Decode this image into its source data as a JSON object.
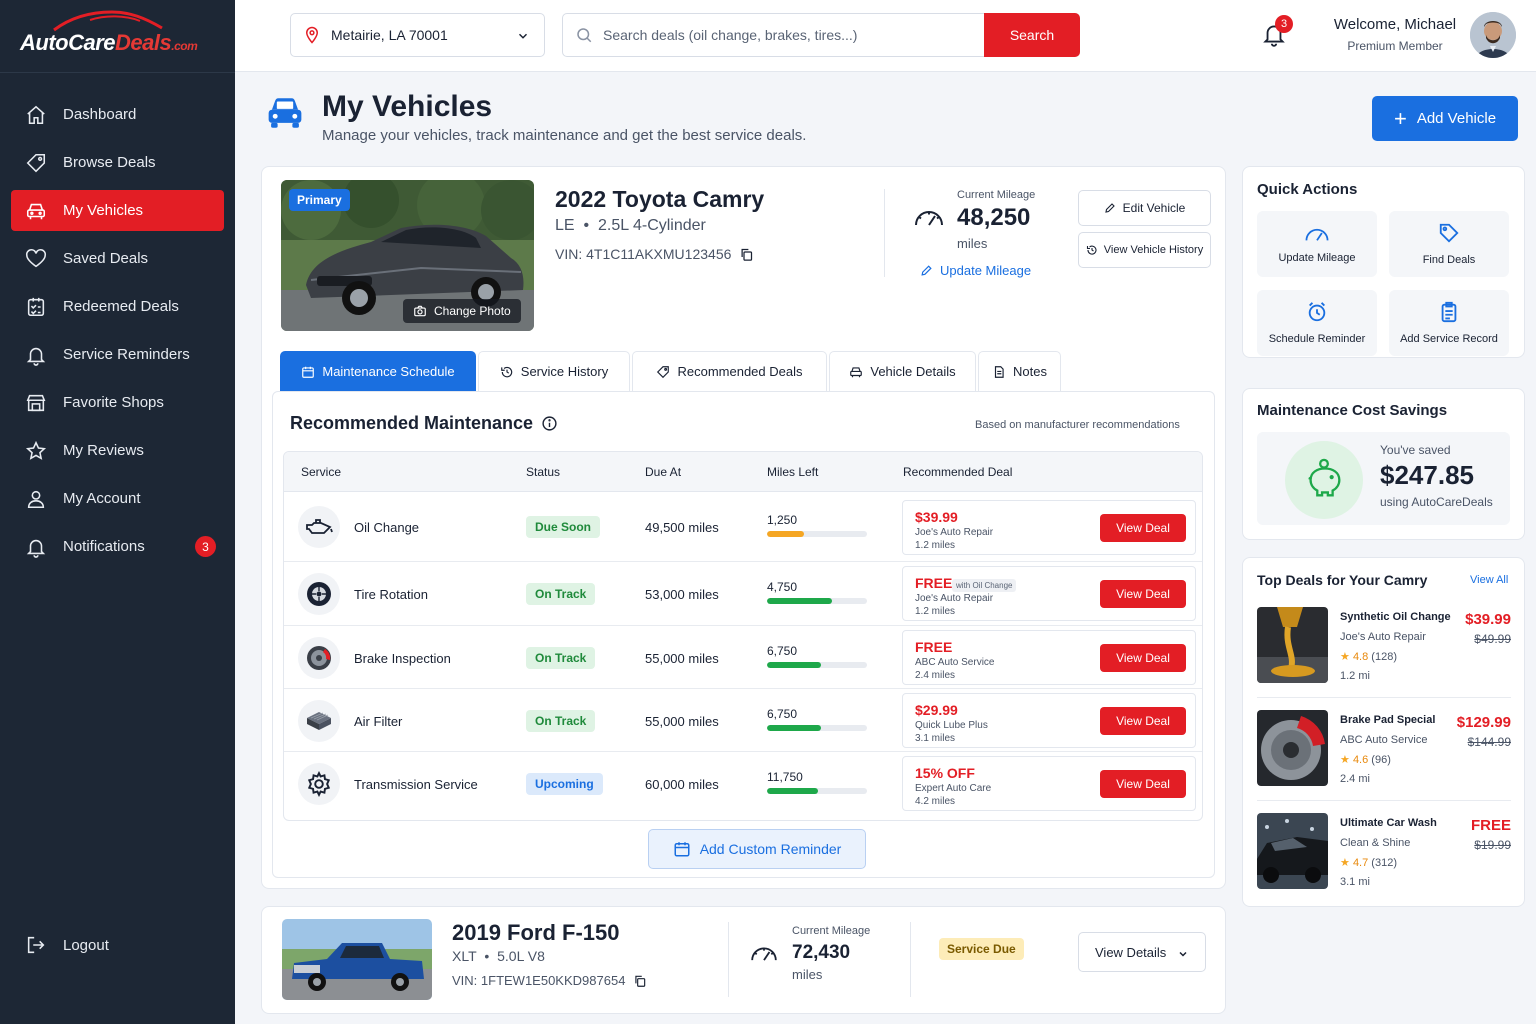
{
  "brand": {
    "part1": "AutoCare",
    "part2": "Deals",
    "suffix": ".com"
  },
  "sidebar": {
    "items": [
      {
        "label": "Dashboard"
      },
      {
        "label": "Browse Deals"
      },
      {
        "label": "My Vehicles"
      },
      {
        "label": "Saved Deals"
      },
      {
        "label": "Redeemed Deals"
      },
      {
        "label": "Service Reminders"
      },
      {
        "label": "Favorite Shops"
      },
      {
        "label": "My Reviews"
      },
      {
        "label": "My Account"
      },
      {
        "label": "Notifications",
        "badge": "3"
      }
    ],
    "logout": "Logout"
  },
  "header": {
    "location": "Metairie, LA 70001",
    "search_placeholder": "Search deals (oil change, brakes, tires...)",
    "search_button": "Search",
    "notif_count": "3",
    "welcome": "Welcome, Michael",
    "member": "Premium Member"
  },
  "page": {
    "title": "My Vehicles",
    "subtitle": "Manage your vehicles, track maintenance and get the best service deals.",
    "add_vehicle": "Add Vehicle"
  },
  "vehicle1": {
    "badge": "Primary",
    "change_photo": "Change Photo",
    "title": "2022 Toyota Camry",
    "trim": "LE",
    "engine": "2.5L 4-Cylinder",
    "vin": "VIN: 4T1C11AKXMU123456",
    "mileage_label": "Current Mileage",
    "mileage": "48,250",
    "mileage_unit": "miles",
    "update_mileage": "Update Mileage",
    "edit": "Edit Vehicle",
    "history": "View Vehicle History"
  },
  "tabs": [
    "Maintenance Schedule",
    "Service History",
    "Recommended Deals",
    "Vehicle Details",
    "Notes"
  ],
  "maintenance": {
    "title": "Recommended Maintenance",
    "note": "Based on manufacturer recommendations",
    "columns": [
      "Service",
      "Status",
      "Due At",
      "Miles Left",
      "Recommended Deal"
    ],
    "rows": [
      {
        "service": "Oil Change",
        "status": "Due Soon",
        "due": "49,500 miles",
        "miles_left": "1,250",
        "progress": 0.37,
        "bar_color": "#f5a623",
        "price": "$39.99",
        "tag": "",
        "shop": "Joe's Auto Repair",
        "dist": "1.2 miles",
        "cta": "View Deal"
      },
      {
        "service": "Tire Rotation",
        "status": "On Track",
        "due": "53,000 miles",
        "miles_left": "4,750",
        "progress": 0.65,
        "bar_color": "#1ea84a",
        "price": "FREE",
        "tag": "with Oil Change",
        "shop": "Joe's Auto Repair",
        "dist": "1.2 miles",
        "cta": "View Deal"
      },
      {
        "service": "Brake Inspection",
        "status": "On Track",
        "due": "55,000 miles",
        "miles_left": "6,750",
        "progress": 0.54,
        "bar_color": "#1ea84a",
        "price": "FREE",
        "tag": "",
        "shop": "ABC Auto Service",
        "dist": "2.4 miles",
        "cta": "View Deal"
      },
      {
        "service": "Air Filter",
        "status": "On Track",
        "due": "55,000 miles",
        "miles_left": "6,750",
        "progress": 0.54,
        "bar_color": "#1ea84a",
        "price": "$29.99",
        "tag": "",
        "shop": "Quick Lube Plus",
        "dist": "3.1 miles",
        "cta": "View Deal"
      },
      {
        "service": "Transmission Service",
        "status": "Upcoming",
        "due": "60,000 miles",
        "miles_left": "11,750",
        "progress": 0.51,
        "bar_color": "#1ea84a",
        "price": "15% OFF",
        "tag": "",
        "shop": "Expert Auto Care",
        "dist": "4.2 miles",
        "cta": "View Deal"
      }
    ],
    "add_reminder": "Add Custom Reminder"
  },
  "vehicle2": {
    "title": "2019 Ford F-150",
    "trim": "XLT",
    "engine": "5.0L V8",
    "vin": "VIN: 1FTEW1E50KKD987654",
    "mileage_label": "Current Mileage",
    "mileage": "72,430",
    "mileage_unit": "miles",
    "status": "Service Due",
    "details": "View Details"
  },
  "quick_actions": {
    "title": "Quick Actions",
    "items": [
      "Update Mileage",
      "Find Deals",
      "Schedule Reminder",
      "Add Service Record"
    ]
  },
  "savings": {
    "title": "Maintenance Cost Savings",
    "label": "You've saved",
    "amount": "$247.85",
    "via": "using AutoCareDeals"
  },
  "top_deals": {
    "title": "Top Deals for Your Camry",
    "view_all": "View All",
    "items": [
      {
        "name": "Synthetic Oil Change",
        "shop": "Joe's Auto Repair",
        "rating": "4.8",
        "reviews": "(128)",
        "dist": "1.2 mi",
        "price": "$39.99",
        "old": "$49.99"
      },
      {
        "name": "Brake Pad Special",
        "shop": "ABC Auto Service",
        "rating": "4.6",
        "reviews": "(96)",
        "dist": "2.4 mi",
        "price": "$129.99",
        "old": "$144.99"
      },
      {
        "name": "Ultimate Car Wash",
        "shop": "Clean & Shine",
        "rating": "4.7",
        "reviews": "(312)",
        "dist": "3.1 mi",
        "price": "FREE",
        "old": "$19.99"
      }
    ]
  },
  "colors": {
    "brand_red": "#e31e25",
    "accent_blue": "#1a6fe0",
    "sidebar_bg": "#1d2735"
  }
}
